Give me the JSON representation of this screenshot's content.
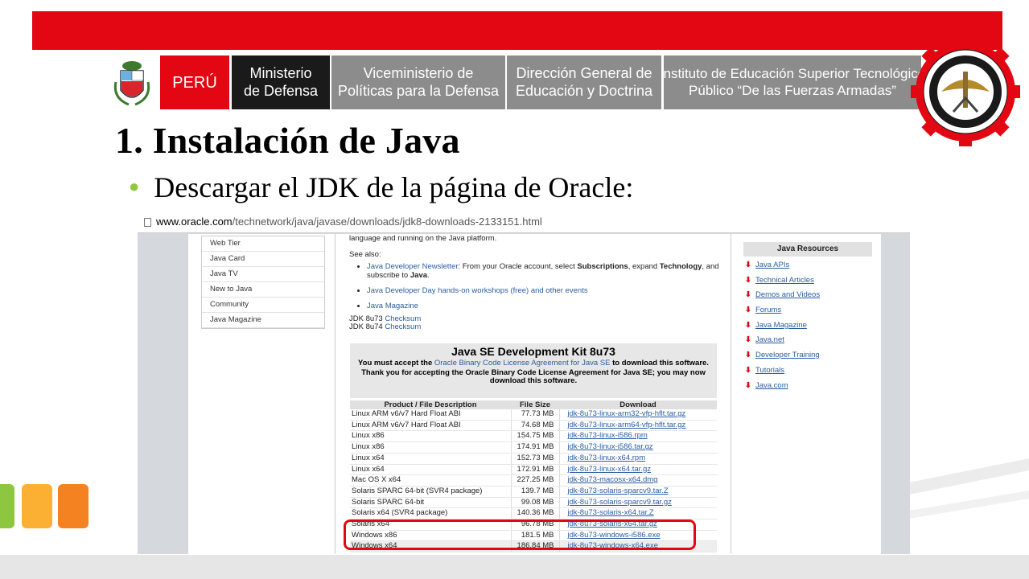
{
  "header": {
    "peru": "PERÚ",
    "ministerio_line1": "Ministerio",
    "ministerio_line2": "de Defensa",
    "viceministerio_line1": "Viceministerio de",
    "viceministerio_line2": "Políticas para la Defensa",
    "direccion_line1": "Dirección General de",
    "direccion_line2": "Educación y Doctrina",
    "instituto_line1": "Instituto de Educación Superior Tecnológico",
    "instituto_line2": "Público “De las Fuerzas Armadas”",
    "seal_text_top": "MINISTERIO DE DEFENSA",
    "seal_text_bottom": "INSTITUTO DE EDUCACIÓN SUPERIOR TECNOLÓGICO PÚBLICO DE LAS FUERZAS ARMADAS"
  },
  "colors": {
    "red": "#e30613",
    "dark": "#1a1a1a",
    "gray": "#8c8c8c",
    "bullet_green": "#8dc63f",
    "link_blue": "#2a5d9f"
  },
  "slide": {
    "title": "1. Instalación de Java",
    "bullet": "Descargar el JDK de la página de Oracle:"
  },
  "browser": {
    "url_host": "www.oracle.com",
    "url_path": "/technetwork/java/javase/downloads/jdk8-downloads-2133151.html",
    "page_icon": "page-icon"
  },
  "left_nav": [
    "Web Tier",
    "Java Card",
    "Java TV",
    "New to Java",
    "Community",
    "Java Magazine"
  ],
  "main": {
    "intro": "language and running on the Java platform.",
    "see_also": "See also:",
    "newsletter_link": "Java Developer Newsletter",
    "newsletter_text": ": From your Oracle account, select ",
    "newsletter_bold1": "Subscriptions",
    "newsletter_text2": ", expand ",
    "newsletter_bold2": "Technology",
    "newsletter_text3": ", and subscribe to ",
    "newsletter_bold3": "Java",
    "newsletter_end": ".",
    "devday": "Java Developer Day hands-on workshops (free) and other events",
    "magazine": "Java Magazine",
    "jdk73": "JDK 8u73",
    "jdk74": "JDK 8u74",
    "checksum": "Checksum"
  },
  "jdk_box": {
    "heading": "Java SE Development Kit 8u73",
    "accept_pre": "You must accept the ",
    "accept_link": "Oracle Binary Code License Agreement for Java SE",
    "accept_post": " to download this software.",
    "thanks": "Thank you for accepting the Oracle Binary Code License Agreement for Java SE; you may now download this software."
  },
  "downloads": {
    "headers": [
      "Product / File Description",
      "File Size",
      "Download"
    ],
    "rows": [
      {
        "desc": "Linux ARM v6/v7 Hard Float ABI",
        "size": "77.73 MB",
        "file": "jdk-8u73-linux-arm32-vfp-hflt.tar.gz"
      },
      {
        "desc": "Linux ARM v6/v7 Hard Float ABI",
        "size": "74.68 MB",
        "file": "jdk-8u73-linux-arm64-vfp-hflt.tar.gz"
      },
      {
        "desc": "Linux x86",
        "size": "154.75 MB",
        "file": "jdk-8u73-linux-i586.rpm"
      },
      {
        "desc": "Linux x86",
        "size": "174.91 MB",
        "file": "jdk-8u73-linux-i586.tar.gz"
      },
      {
        "desc": "Linux x64",
        "size": "152.73 MB",
        "file": "jdk-8u73-linux-x64.rpm"
      },
      {
        "desc": "Linux x64",
        "size": "172.91 MB",
        "file": "jdk-8u73-linux-x64.tar.gz"
      },
      {
        "desc": "Mac OS X x64",
        "size": "227.25 MB",
        "file": "jdk-8u73-macosx-x64.dmg"
      },
      {
        "desc": "Solaris SPARC 64-bit (SVR4 package)",
        "size": "139.7 MB",
        "file": "jdk-8u73-solaris-sparcv9.tar.Z"
      },
      {
        "desc": "Solaris SPARC 64-bit",
        "size": "99.08 MB",
        "file": "jdk-8u73-solaris-sparcv9.tar.gz"
      },
      {
        "desc": "Solaris x64 (SVR4 package)",
        "size": "140.36 MB",
        "file": "jdk-8u73-solaris-x64.tar.Z"
      },
      {
        "desc": "Solaris x64",
        "size": "96.78 MB",
        "file": "jdk-8u73-solaris-x64.tar.gz"
      },
      {
        "desc": "Windows x86",
        "size": "181.5 MB",
        "file": "jdk-8u73-windows-i586.exe"
      },
      {
        "desc": "Windows x64",
        "size": "186.84 MB",
        "file": "jdk-8u73-windows-x64.exe"
      }
    ]
  },
  "resources": {
    "heading": "Java Resources",
    "items": [
      "Java APIs",
      "Technical Articles",
      "Demos and Videos",
      "Forums",
      "Java Magazine",
      "Java.net",
      "Developer Training",
      "Tutorials",
      "Java.com"
    ]
  }
}
